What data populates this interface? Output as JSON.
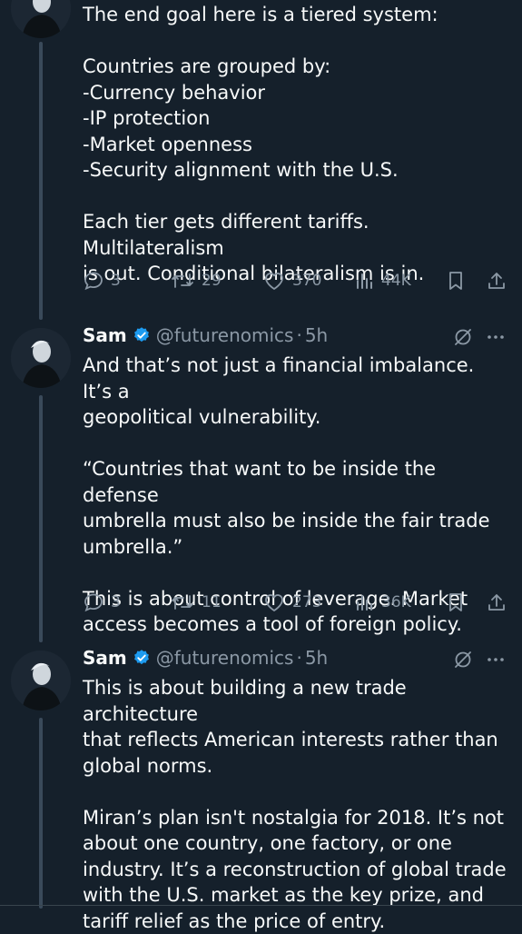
{
  "tweets": [
    {
      "author": "",
      "lines": [
        "The end goal here is a tiered system:",
        "",
        "Countries are grouped by:",
        "-Currency behavior",
        "-IP protection",
        "-Market openness",
        "-Security alignment with the U.S.",
        "",
        "Each tier gets different tariffs. Multilateralism",
        "is out. Conditional bilateralism is in."
      ],
      "replies": "3",
      "retweets": "29",
      "likes": "370",
      "views": "44K"
    },
    {
      "author": "Sam",
      "handle": "@futurenomics",
      "dot": "·",
      "time": "5h",
      "lines": [
        "And that’s not just a financial imbalance. It’s a",
        "geopolitical vulnerability.",
        "",
        "“Countries that want to be inside the defense",
        "umbrella must also be inside the fair trade",
        "umbrella.”",
        "",
        "This is about control of leverage. Market",
        "access becomes a tool of foreign policy."
      ],
      "replies": "3",
      "retweets": "11",
      "likes": "273",
      "views": "36K"
    },
    {
      "author": "Sam",
      "handle": "@futurenomics",
      "dot": "·",
      "time": "5h",
      "lines": [
        "This is about building a new trade architecture",
        "that reflects American interests rather than",
        "global norms.",
        "",
        "Miran’s plan isn't nostalgia for 2018. It’s not",
        "about one country, one factory, or one",
        "industry. It’s a reconstruction of global trade",
        "with the U.S. market as the key prize, and",
        "tariff relief as the price of entry."
      ]
    }
  ],
  "colors": {
    "background": "#15202b",
    "text": "#f7f9f9",
    "muted": "#8b98a5",
    "verified": "#1d9bf0",
    "thread_line": "#3a4a5a"
  },
  "icons": [
    "reply-icon",
    "retweet-icon",
    "like-icon",
    "views-icon",
    "bookmark-icon",
    "share-icon",
    "verified-badge-icon",
    "grok-icon",
    "more-icon"
  ]
}
